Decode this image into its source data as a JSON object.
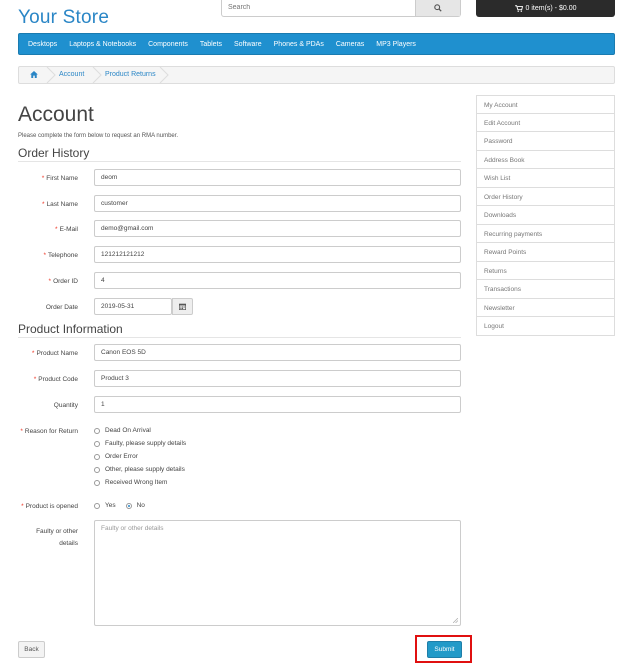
{
  "header": {
    "logo": "Your Store",
    "search_placeholder": "Search",
    "cart_label": "0 item(s) - $0.00"
  },
  "menu": [
    "Desktops",
    "Laptops & Notebooks",
    "Components",
    "Tablets",
    "Software",
    "Phones & PDAs",
    "Cameras",
    "MP3 Players"
  ],
  "breadcrumb": [
    "Account",
    "Product Returns"
  ],
  "page": {
    "title": "Account",
    "intro": "Please complete the form below to request an RMA number.",
    "section_order": "Order History",
    "section_product": "Product Information"
  },
  "order": {
    "first_name_label": "First Name",
    "first_name": "deom",
    "last_name_label": "Last Name",
    "last_name": "customer",
    "email_label": "E-Mail",
    "email": "demo@gmail.com",
    "telephone_label": "Telephone",
    "telephone": "121212121212",
    "order_id_label": "Order ID",
    "order_id": "4",
    "order_date_label": "Order Date",
    "order_date": "2019-05-31"
  },
  "product": {
    "name_label": "Product Name",
    "name": "Canon EOS 5D",
    "code_label": "Product Code",
    "code": "Product 3",
    "quantity_label": "Quantity",
    "quantity": "1",
    "reason_label": "Reason for Return",
    "reasons": [
      "Dead On Arrival",
      "Faulty, please supply details",
      "Order Error",
      "Other, please supply details",
      "Received Wrong Item"
    ],
    "opened_label": "Product is opened",
    "opened_yes": "Yes",
    "opened_no": "No",
    "details_label_1": "Faulty or other",
    "details_label_2": "details",
    "details_placeholder": "Faulty or other details"
  },
  "buttons": {
    "back": "Back",
    "submit": "Submit"
  },
  "sidebar": [
    "My Account",
    "Edit Account",
    "Password",
    "Address Book",
    "Wish List",
    "Order History",
    "Downloads",
    "Recurring payments",
    "Reward Points",
    "Returns",
    "Transactions",
    "Newsletter",
    "Logout"
  ],
  "colors": {
    "brand": "#2a86c6",
    "menu": "#1f90cf",
    "submit": "#229ac8",
    "highlight": "#e01010"
  }
}
